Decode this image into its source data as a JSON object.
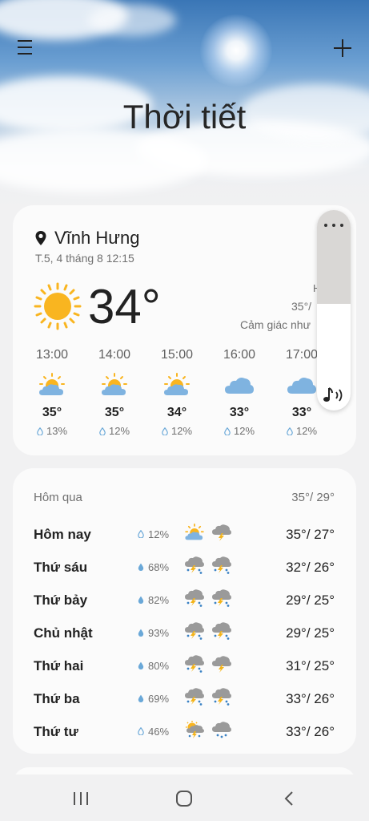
{
  "header": {
    "title": "Thời tiết"
  },
  "current": {
    "location": "Vĩnh Hưng",
    "datetime": "T.5, 4 tháng 8 12:15",
    "temperature": "34°",
    "hl_mark": "H",
    "hi_lo": "35°/",
    "feels_like": "Cảm giác như",
    "icon": "sunny-icon"
  },
  "hourly": [
    {
      "time": "13:00",
      "temp": "35°",
      "precip": "13%",
      "icon": "partly-cloudy-icon"
    },
    {
      "time": "14:00",
      "temp": "35°",
      "precip": "12%",
      "icon": "partly-cloudy-icon"
    },
    {
      "time": "15:00",
      "temp": "34°",
      "precip": "12%",
      "icon": "partly-cloudy-icon"
    },
    {
      "time": "16:00",
      "temp": "33°",
      "precip": "12%",
      "icon": "cloudy-icon"
    },
    {
      "time": "17:00",
      "temp": "33°",
      "precip": "12%",
      "icon": "cloudy-icon"
    }
  ],
  "daily": {
    "yesterday_label": "Hôm qua",
    "yesterday_range": "35°/ 29°",
    "days": [
      {
        "name": "Hôm nay",
        "precip": "12%",
        "range": "35°/ 27°",
        "icons": [
          "partly-cloudy-icon",
          "thunder-cloud-icon"
        ]
      },
      {
        "name": "Thứ sáu",
        "precip": "68%",
        "range": "32°/ 26°",
        "icons": [
          "thunder-rain-icon",
          "thunder-rain-icon"
        ]
      },
      {
        "name": "Thứ bảy",
        "precip": "82%",
        "range": "29°/ 25°",
        "icons": [
          "thunder-rain-icon",
          "thunder-rain-icon"
        ]
      },
      {
        "name": "Chủ nhật",
        "precip": "93%",
        "range": "29°/ 25°",
        "icons": [
          "thunder-rain-icon",
          "thunder-rain-icon"
        ]
      },
      {
        "name": "Thứ hai",
        "precip": "80%",
        "range": "31°/ 25°",
        "icons": [
          "thunder-rain-icon",
          "thunder-cloud-icon"
        ]
      },
      {
        "name": "Thứ ba",
        "precip": "69%",
        "range": "33°/ 26°",
        "icons": [
          "thunder-rain-icon",
          "thunder-rain-icon"
        ]
      },
      {
        "name": "Thứ tư",
        "precip": "46%",
        "range": "33°/ 26°",
        "icons": [
          "sun-thunder-rain-icon",
          "rain-icon"
        ]
      }
    ]
  },
  "colors": {
    "sun": "#f9b520",
    "cloud": "#7fb3e0",
    "rain_drop": "#6aa8d8",
    "bolt": "#f4b41a"
  }
}
